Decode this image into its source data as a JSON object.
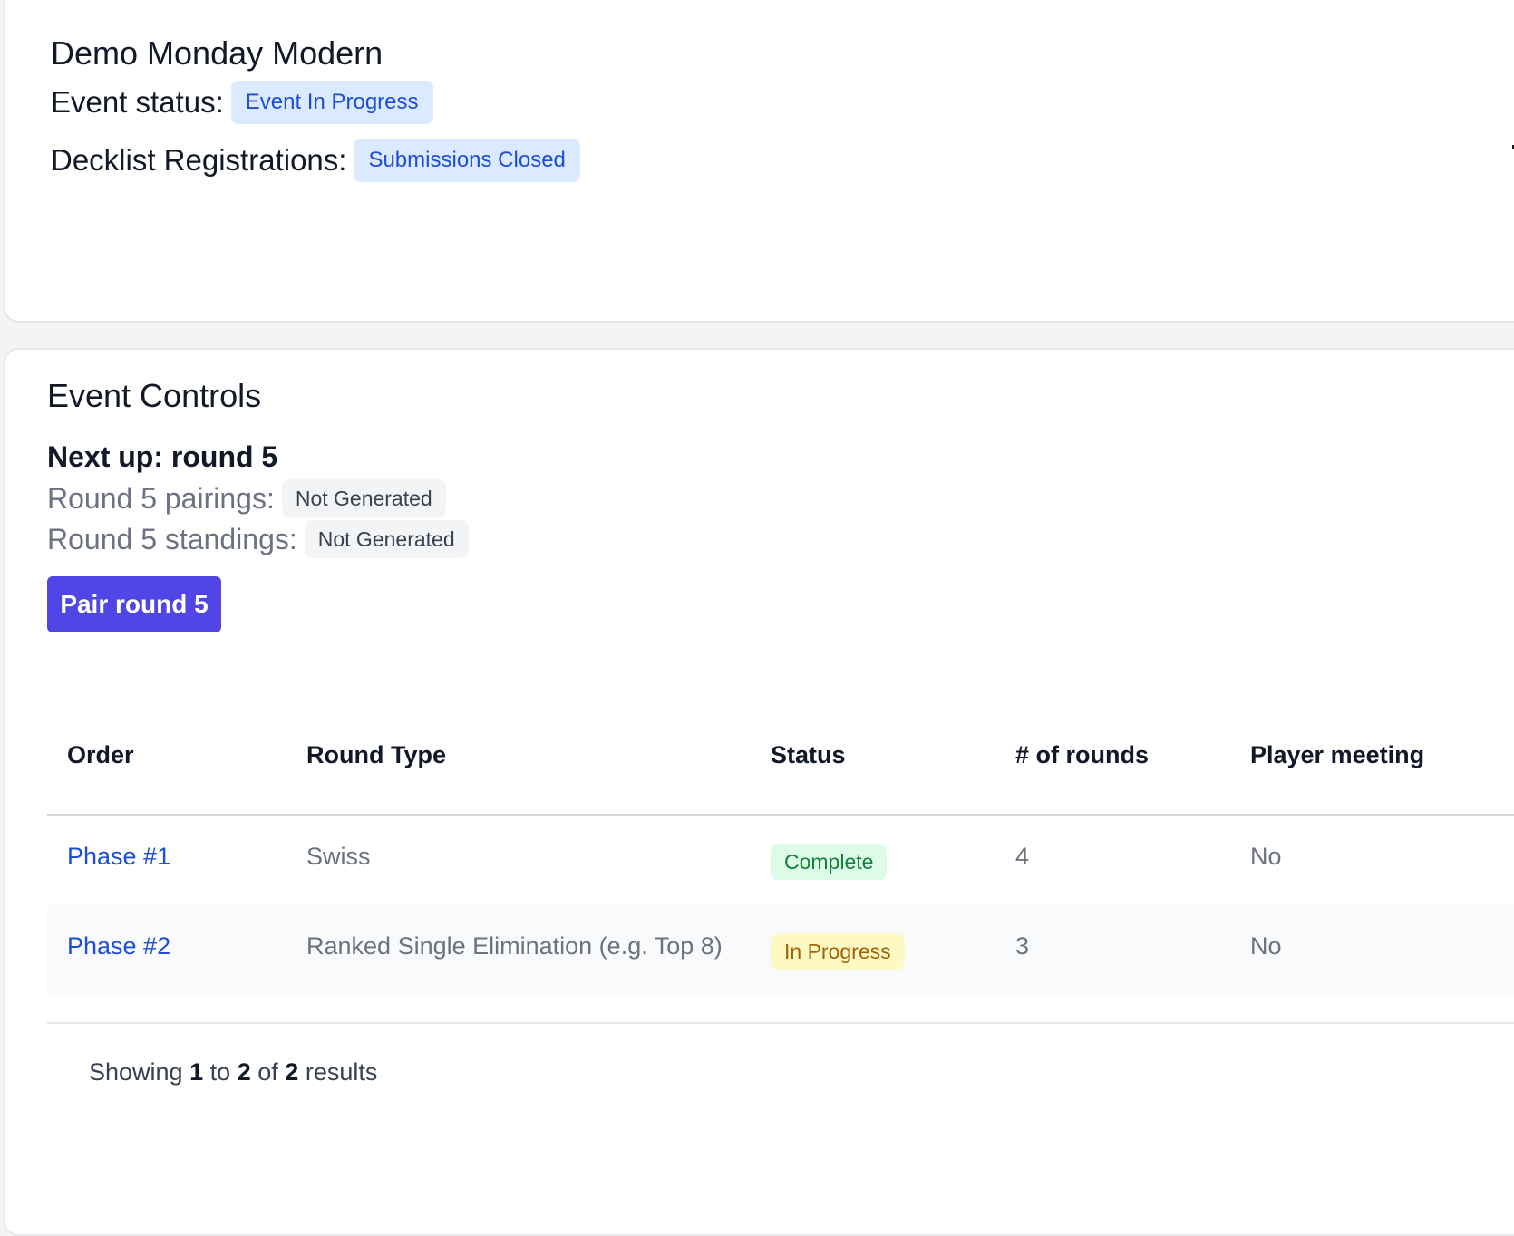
{
  "event": {
    "title": "Demo Monday Modern",
    "status_label": "Event status:",
    "status_value": "Event In Progress",
    "decklist_label": "Decklist Registrations:",
    "decklist_value": "Submissions Closed"
  },
  "controls": {
    "title": "Event Controls",
    "next_up": "Next up: round 5",
    "pairings_label": "Round 5 pairings:",
    "pairings_value": "Not Generated",
    "standings_label": "Round 5 standings:",
    "standings_value": "Not Generated",
    "pair_button": "Pair round 5"
  },
  "table": {
    "headers": {
      "order": "Order",
      "round_type": "Round Type",
      "status": "Status",
      "rounds": "# of rounds",
      "meeting": "Player meeting"
    },
    "rows": [
      {
        "order": "Phase #1",
        "round_type": "Swiss",
        "status": "Complete",
        "rounds": "4",
        "meeting": "No"
      },
      {
        "order": "Phase #2",
        "round_type": "Ranked Single Elimination (e.g. Top 8)",
        "status": "In Progress",
        "rounds": "3",
        "meeting": "No"
      }
    ],
    "footer": {
      "prefix": "Showing",
      "from": "1",
      "to_word": "to",
      "to": "2",
      "of_word": "of",
      "total": "2",
      "suffix": "results"
    }
  },
  "colors": {
    "primary_button": "#4f46e5",
    "badge_blue": "#dbeafe",
    "badge_green": "#dcfce7",
    "badge_yellow": "#fef9c3",
    "badge_gray": "#f3f4f6",
    "link": "#1d4ed8"
  }
}
